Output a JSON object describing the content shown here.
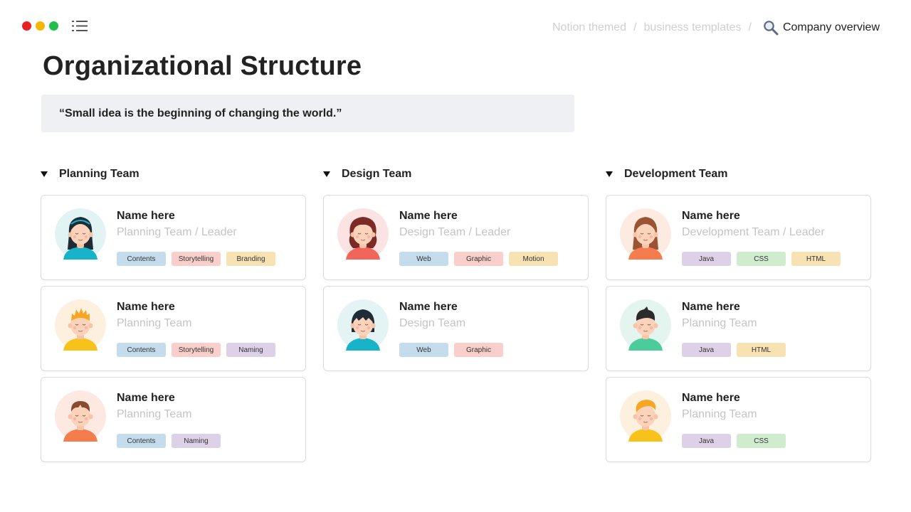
{
  "window": {
    "dots": [
      "#e8201e",
      "#f5b800",
      "#1fbf4a"
    ],
    "menu_icon": "list-icon"
  },
  "breadcrumb": {
    "items": [
      "Notion themed",
      "business templates"
    ],
    "separator": "/",
    "current": "Company overview",
    "current_icon": "search-icon"
  },
  "page": {
    "title": "Organizational Structure",
    "quote": "“Small idea is the beginning of changing the world.”"
  },
  "tag_colors": {
    "blue": "#c5dced",
    "pink": "#f8cfca",
    "yellow": "#f7e2b4",
    "purple": "#ddd1e8",
    "green": "#cfeccf"
  },
  "columns": [
    {
      "title": "Planning Team",
      "cards": [
        {
          "name": "Name here",
          "role": "Planning Team / Leader",
          "avatar": "girl-black-hair-avatar",
          "tags": [
            {
              "label": "Contents",
              "color": "blue"
            },
            {
              "label": "Storytelling",
              "color": "pink"
            },
            {
              "label": "Branding",
              "color": "yellow"
            }
          ]
        },
        {
          "name": "Name here",
          "role": "Planning Team",
          "avatar": "boy-orange-hair-avatar",
          "tags": [
            {
              "label": "Contents",
              "color": "blue"
            },
            {
              "label": "Storytelling",
              "color": "pink"
            },
            {
              "label": "Naming",
              "color": "purple"
            }
          ]
        },
        {
          "name": "Name here",
          "role": "Planning Team",
          "avatar": "boy-brown-hair-avatar",
          "tags": [
            {
              "label": "Contents",
              "color": "blue"
            },
            {
              "label": "Naming",
              "color": "purple"
            }
          ]
        }
      ]
    },
    {
      "title": "Design Team",
      "cards": [
        {
          "name": "Name here",
          "role": "Design Team / Leader",
          "avatar": "girl-red-hair-avatar",
          "tags": [
            {
              "label": "Web",
              "color": "blue"
            },
            {
              "label": "Graphic",
              "color": "pink"
            },
            {
              "label": "Motion",
              "color": "yellow"
            }
          ]
        },
        {
          "name": "Name here",
          "role": "Design Team",
          "avatar": "girl-dark-bob-avatar",
          "tags": [
            {
              "label": "Web",
              "color": "blue"
            },
            {
              "label": "Graphic",
              "color": "pink"
            }
          ]
        }
      ]
    },
    {
      "title": "Development Team",
      "cards": [
        {
          "name": "Name here",
          "role": "Development Team / Leader",
          "avatar": "girl-brown-hair-avatar",
          "tags": [
            {
              "label": "Java",
              "color": "purple"
            },
            {
              "label": "CSS",
              "color": "green"
            },
            {
              "label": "HTML",
              "color": "yellow"
            }
          ]
        },
        {
          "name": "Name here",
          "role": "Planning Team",
          "avatar": "boy-dark-hair-avatar",
          "tags": [
            {
              "label": "Java",
              "color": "purple"
            },
            {
              "label": "HTML",
              "color": "yellow"
            }
          ]
        },
        {
          "name": "Name here",
          "role": "Planning Team",
          "avatar": "boy-yellow-hair-avatar",
          "tags": [
            {
              "label": "Java",
              "color": "purple"
            },
            {
              "label": "CSS",
              "color": "green"
            }
          ]
        }
      ]
    }
  ]
}
